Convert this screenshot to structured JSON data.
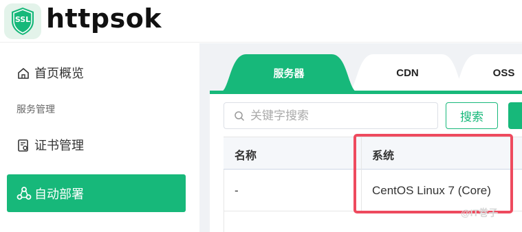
{
  "header": {
    "logo_text": "SSL",
    "brand": "httpsok"
  },
  "sidebar": {
    "home": "首页概览",
    "section": "服务管理",
    "cert": "证书管理",
    "deploy": "自动部署"
  },
  "tabs": [
    "服务器",
    "CDN",
    "OSS"
  ],
  "search": {
    "placeholder": "关键字搜索",
    "button": "搜索"
  },
  "table": {
    "columns": [
      "名称",
      "系统"
    ],
    "rows": [
      {
        "name": "-",
        "system": "CentOS Linux 7 (Core)"
      }
    ]
  },
  "watermark": "@IT巻子",
  "colors": {
    "accent": "#17b87a",
    "highlight": "#ee4a5e"
  }
}
